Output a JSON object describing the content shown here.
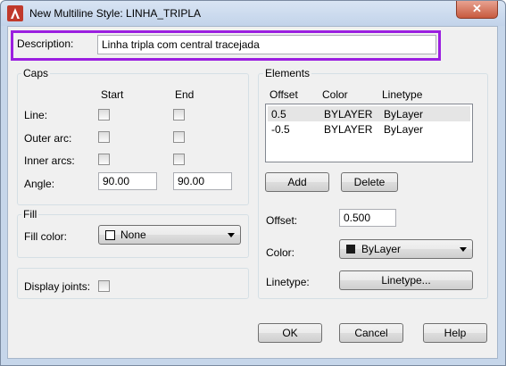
{
  "window": {
    "title": "New Multiline Style: LINHA_TRIPLA",
    "close_label": "✕"
  },
  "description": {
    "label": "Description:",
    "value": "Linha tripla com central tracejada"
  },
  "caps": {
    "title": "Caps",
    "col_start": "Start",
    "col_end": "End",
    "line_label": "Line:",
    "outer_arc_label": "Outer arc:",
    "inner_arcs_label": "Inner arcs:",
    "angle_label": "Angle:",
    "angle_start": "90.00",
    "angle_end": "90.00"
  },
  "fill": {
    "title": "Fill",
    "color_label": "Fill color:",
    "color_value": "None",
    "swatch_color": "#ffffff"
  },
  "display_joints_label": "Display joints:",
  "elements": {
    "title": "Elements",
    "headers": [
      "Offset",
      "Color",
      "Linetype"
    ],
    "rows": [
      {
        "offset": "0.5",
        "color": "BYLAYER",
        "linetype": "ByLayer"
      },
      {
        "offset": "-0.5",
        "color": "BYLAYER",
        "linetype": "ByLayer"
      }
    ],
    "add_label": "Add",
    "delete_label": "Delete",
    "offset_label": "Offset:",
    "offset_value": "0.500",
    "color_label": "Color:",
    "color_value": "ByLayer",
    "color_swatch": "#1a1a1a",
    "linetype_label": "Linetype:",
    "linetype_button": "Linetype..."
  },
  "buttons": {
    "ok": "OK",
    "cancel": "Cancel",
    "help": "Help"
  },
  "colors": {
    "highlight": "#9b1fe0",
    "selected_row": "#e5e5e5"
  }
}
